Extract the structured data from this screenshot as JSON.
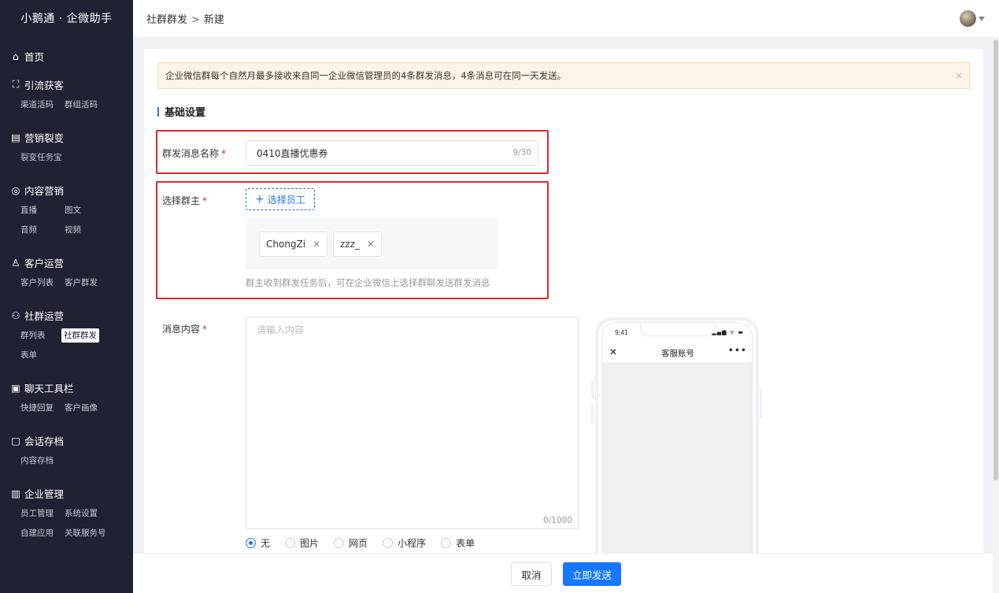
{
  "app": {
    "title": "小鹅通 · 企微助手"
  },
  "sidebar": {
    "groups": [
      {
        "label": "首页",
        "icon": "home-icon",
        "items": []
      },
      {
        "label": "引流获客",
        "icon": "sitemap-icon",
        "items": [
          "渠道活码",
          "群组活码"
        ]
      },
      {
        "label": "营销裂变",
        "icon": "split-icon",
        "items": [
          "裂变任务宝"
        ]
      },
      {
        "label": "内容营销",
        "icon": "content-icon",
        "items": [
          "直播",
          "图文",
          "音频",
          "视频"
        ]
      },
      {
        "label": "客户运营",
        "icon": "user-icon",
        "items": [
          "客户列表",
          "客户群发"
        ]
      },
      {
        "label": "社群运营",
        "icon": "group-icon",
        "items": [
          "群列表",
          "社群群发",
          "表单"
        ]
      },
      {
        "label": "聊天工具栏",
        "icon": "toolbar-icon",
        "items": [
          "快捷回复",
          "客户画像"
        ]
      },
      {
        "label": "会话存档",
        "icon": "archive-icon",
        "items": [
          "内容存档"
        ]
      },
      {
        "label": "企业管理",
        "icon": "building-icon",
        "items": [
          "员工管理",
          "系统设置",
          "自建应用",
          "关联服务号"
        ]
      }
    ],
    "active_item": "社群群发"
  },
  "header": {
    "breadcrumb": [
      "社群群发",
      "新建"
    ],
    "separator": ">"
  },
  "alert": {
    "text": "企业微信群每个自然月最多接收来自同一企业微信管理员的4条群发消息，4条消息可在同一天发送。",
    "close": "×"
  },
  "section": {
    "title": "基础设置"
  },
  "form": {
    "name_label": "群发消息名称",
    "name_value": "0410直播优惠券",
    "name_count": "9/30",
    "owner_label": "选择群主",
    "owner_button": "选择员工",
    "owner_tags": [
      "ChongZi",
      "zzz_"
    ],
    "owner_helper": "群主收到群发任务后，可在企业微信上选择群聊发送群发消息",
    "content_label": "消息内容",
    "content_placeholder": "请输入内容",
    "content_count": "0/1000",
    "required_mark": "*",
    "attach_options": [
      "无",
      "图片",
      "网页",
      "小程序",
      "表单"
    ],
    "attach_selected": "无"
  },
  "preview": {
    "time": "9:41",
    "status": "▂▄▆ ᯤ ▬",
    "title": "客服账号",
    "close": "✕",
    "more": "•••"
  },
  "footer": {
    "cancel_label": "取消",
    "send_label": "立即发送"
  },
  "colors": {
    "sidebar_bg": "#1f2233",
    "accent": "#1677ff",
    "highlight_border": "#e0262c",
    "alert_bg": "#fdf3e6"
  }
}
